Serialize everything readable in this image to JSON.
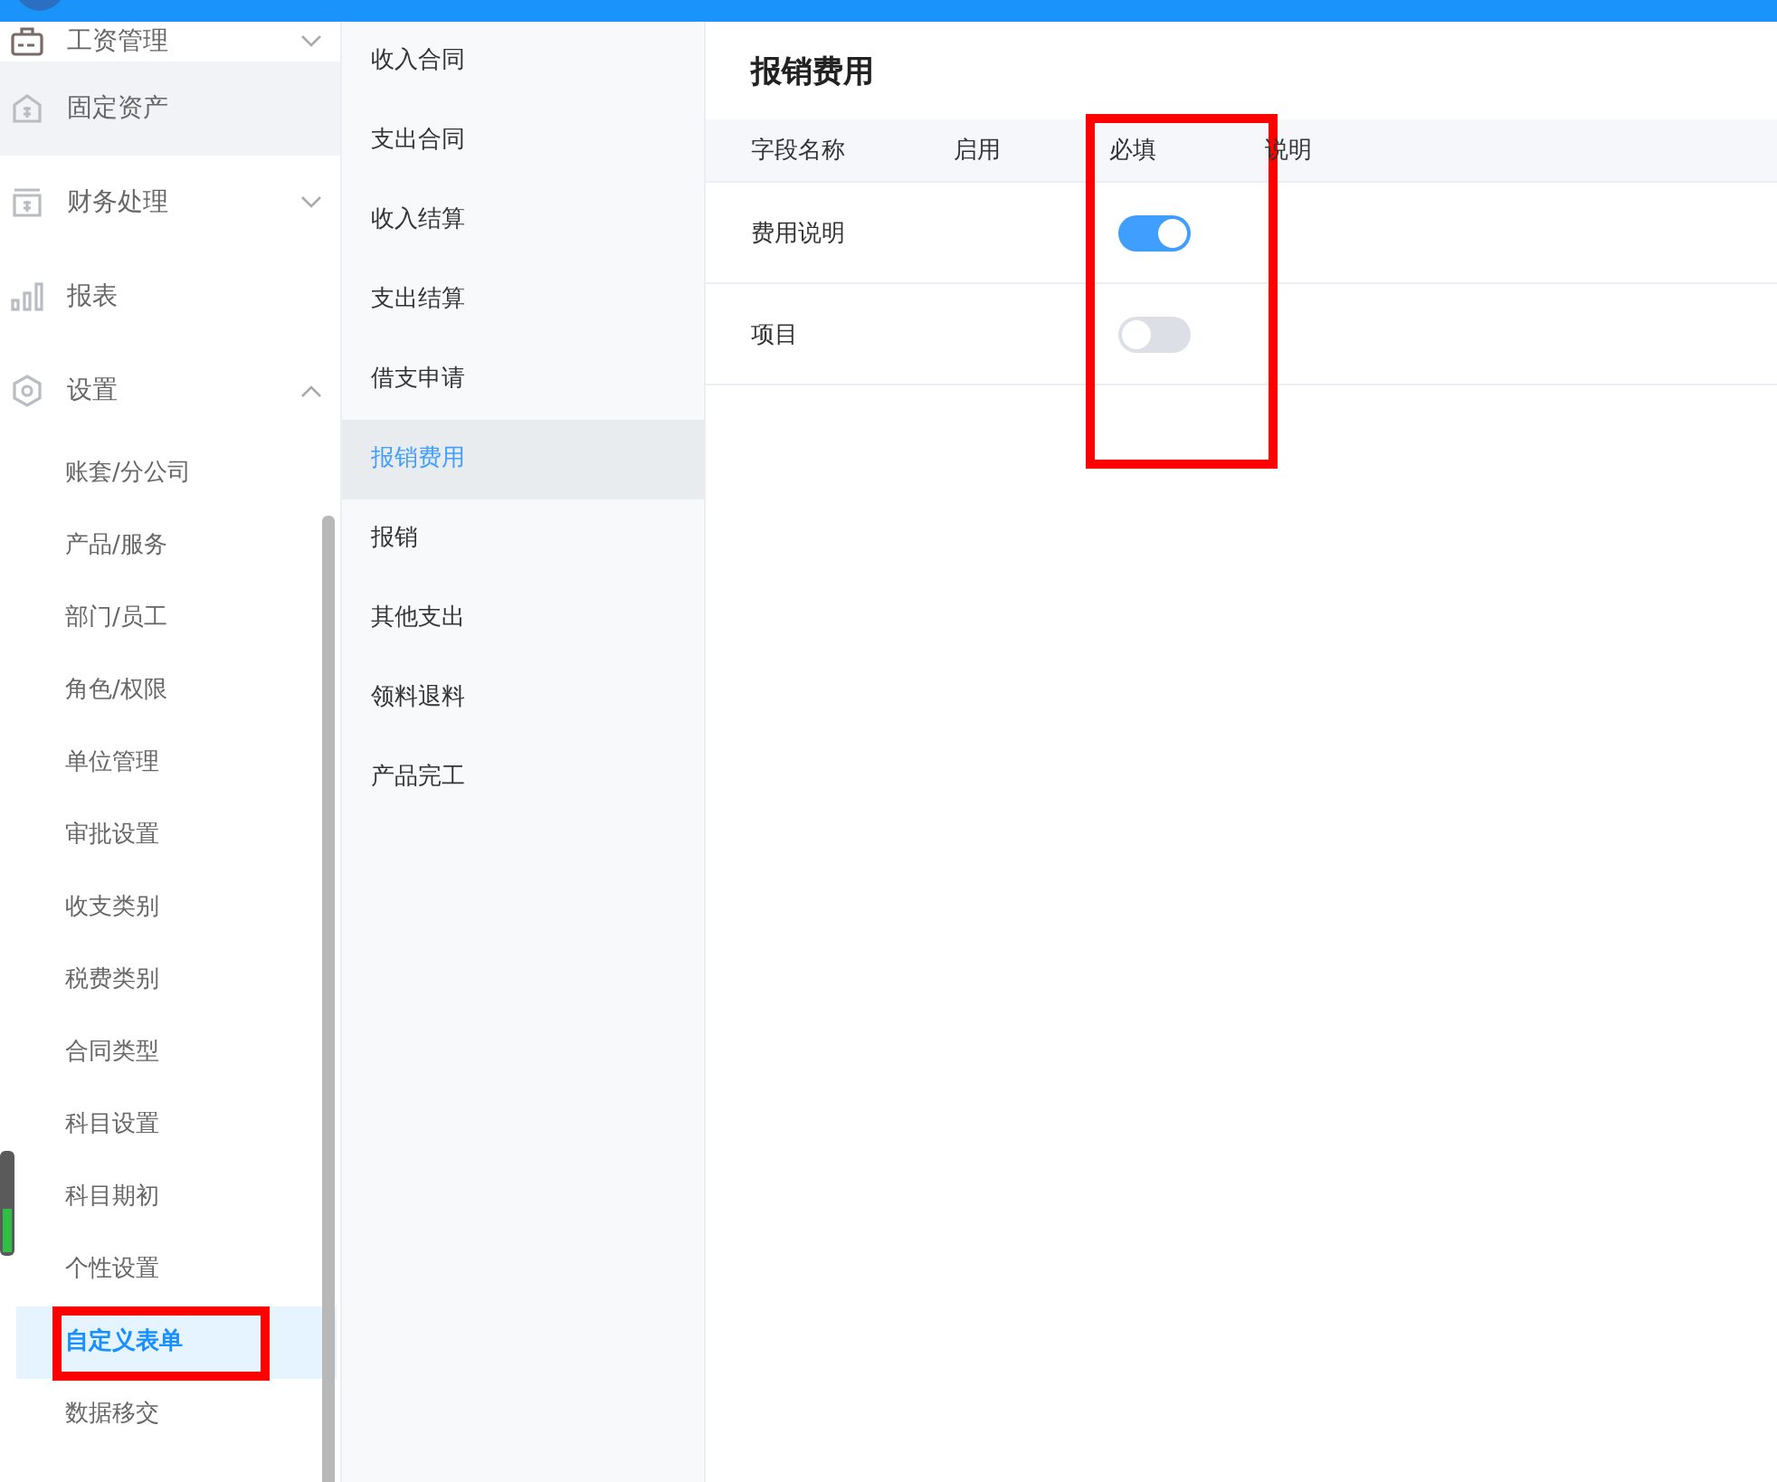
{
  "sidebar": {
    "items": [
      {
        "label": "工资管理",
        "expanded": false
      },
      {
        "label": "固定资产",
        "selected": true
      },
      {
        "label": "财务处理",
        "expanded": false
      },
      {
        "label": "报表",
        "selected": false
      },
      {
        "label": "设置",
        "expanded": true,
        "children": [
          {
            "label": "账套/分公司",
            "selected": false,
            "highlighted": false
          },
          {
            "label": "产品/服务",
            "selected": false,
            "highlighted": false
          },
          {
            "label": "部门/员工",
            "selected": false,
            "highlighted": false
          },
          {
            "label": "角色/权限",
            "selected": false,
            "highlighted": false
          },
          {
            "label": "单位管理",
            "selected": false,
            "highlighted": false
          },
          {
            "label": "审批设置",
            "selected": false,
            "highlighted": false
          },
          {
            "label": "收支类别",
            "selected": false,
            "highlighted": false
          },
          {
            "label": "税费类别",
            "selected": false,
            "highlighted": false
          },
          {
            "label": "合同类型",
            "selected": false,
            "highlighted": false
          },
          {
            "label": "科目设置",
            "selected": false,
            "highlighted": false
          },
          {
            "label": "科目期初",
            "selected": false,
            "highlighted": false
          },
          {
            "label": "个性设置",
            "selected": false,
            "highlighted": false
          },
          {
            "label": "自定义表单",
            "selected": true,
            "highlighted": true
          },
          {
            "label": "数据移交",
            "selected": false,
            "highlighted": false
          }
        ]
      }
    ]
  },
  "forms": [
    {
      "label": "收入合同",
      "selected": false
    },
    {
      "label": "支出合同",
      "selected": false
    },
    {
      "label": "收入结算",
      "selected": false
    },
    {
      "label": "支出结算",
      "selected": false
    },
    {
      "label": "借支申请",
      "selected": false
    },
    {
      "label": "报销费用",
      "selected": true
    },
    {
      "label": "报销",
      "selected": false
    },
    {
      "label": "其他支出",
      "selected": false
    },
    {
      "label": "领料退料",
      "selected": false
    },
    {
      "label": "产品完工",
      "selected": false
    }
  ],
  "panel": {
    "title": "报销费用",
    "columns": [
      {
        "label": "字段名称",
        "highlighted": false
      },
      {
        "label": "启用",
        "highlighted": false
      },
      {
        "label": "必填",
        "highlighted": true
      },
      {
        "label": "说明",
        "highlighted": false
      }
    ],
    "rows": [
      {
        "name": "费用说明",
        "required": true
      },
      {
        "name": "项目",
        "required": false
      }
    ]
  }
}
